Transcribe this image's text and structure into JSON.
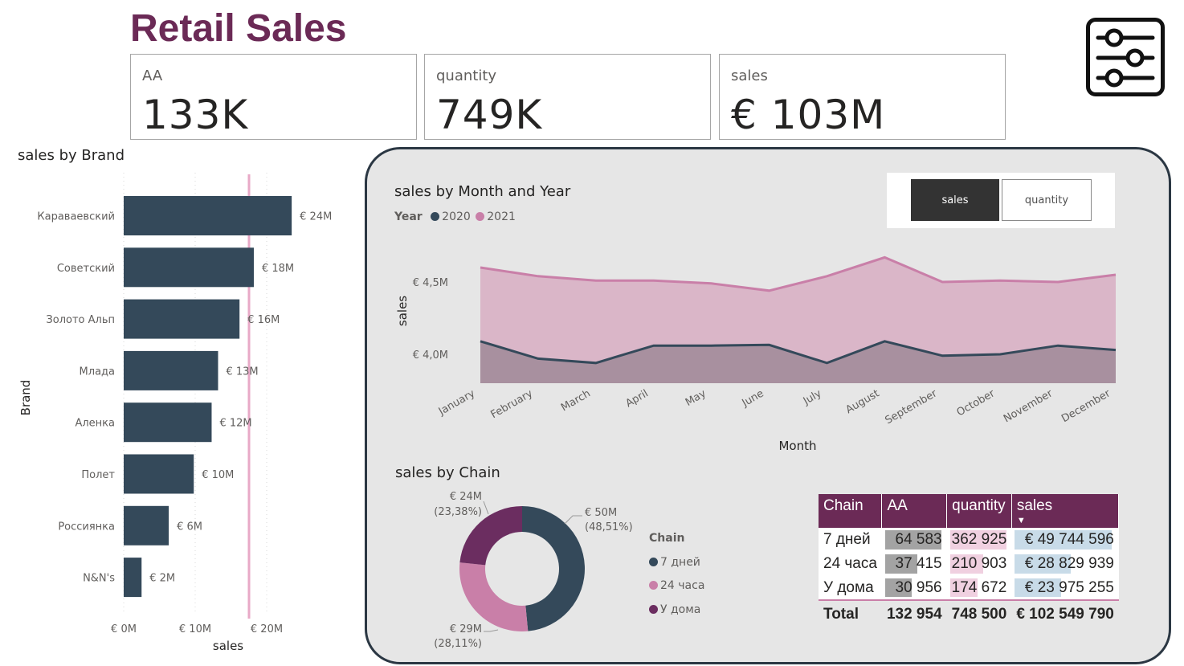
{
  "page": {
    "title": "Retail Sales"
  },
  "kpis": [
    {
      "label": "AA",
      "value": "133K"
    },
    {
      "label": "quantity",
      "value": "749K"
    },
    {
      "label": "sales",
      "value": "€ 103M"
    }
  ],
  "filter_button": {
    "icon": "sliders-icon"
  },
  "brand_chart": {
    "title": "sales by Brand",
    "xlabel": "sales",
    "ylabel": "Brand",
    "x_ticks": [
      "€ 0M",
      "€ 10M",
      "€ 20M"
    ],
    "reference_line_value": 20,
    "bar_color": "#34495a",
    "ref_color": "#e8a9c7"
  },
  "month_chart": {
    "title": "sales by Month and Year",
    "legend_title": "Year",
    "ylabel": "sales",
    "xlabel": "Month",
    "y_ticks": [
      "€ 4,5M",
      "€ 4,0M"
    ],
    "series_colors": {
      "2020": "#34495a",
      "2021": "#c97fa8"
    }
  },
  "measure_toggle": {
    "active": "sales",
    "inactive": "quantity"
  },
  "chain_chart": {
    "title": "sales by Chain",
    "legend_title": "Chain",
    "labels": [
      {
        "value": "€ 50M",
        "pct": "(48,51%)"
      },
      {
        "value": "€ 29M",
        "pct": "(28,11%)"
      },
      {
        "value": "€ 24M",
        "pct": "(23,38%)"
      }
    ]
  },
  "matrix": {
    "headers": [
      "Chain",
      "AA",
      "quantity",
      "sales"
    ],
    "rows": [
      {
        "chain": "7 дней",
        "aa": "64 583",
        "quantity": "362 925",
        "sales": "€ 49 744 596"
      },
      {
        "chain": "24 часа",
        "aa": "37 415",
        "quantity": "210 903",
        "sales": "€ 28 829 939"
      },
      {
        "chain": "У дома",
        "aa": "30 956",
        "quantity": "174 672",
        "sales": "€ 23 975 255"
      }
    ],
    "total": {
      "label": "Total",
      "aa": "132 954",
      "quantity": "748 500",
      "sales": "€ 102 549 790"
    }
  },
  "chart_data": [
    {
      "type": "bar",
      "title": "sales by Brand",
      "xlabel": "sales",
      "ylabel": "Brand",
      "categories": [
        "Караваевский",
        "Советский",
        "Золото Альп",
        "Млада",
        "Аленка",
        "Полет",
        "Россиянка",
        "N&N's"
      ],
      "values": [
        23.5,
        18.2,
        16.2,
        13.2,
        12.3,
        9.8,
        6.3,
        2.5
      ],
      "data_labels": [
        "€ 24M",
        "€ 18M",
        "€ 16M",
        "€ 13M",
        "€ 12M",
        "€ 10M",
        "€ 6M",
        "€ 2M"
      ],
      "xlim": [
        0,
        30
      ]
    },
    {
      "type": "area",
      "title": "sales by Month and Year",
      "xlabel": "Month",
      "ylabel": "sales",
      "categories": [
        "January",
        "February",
        "March",
        "April",
        "May",
        "June",
        "July",
        "August",
        "September",
        "October",
        "November",
        "December"
      ],
      "series": [
        {
          "name": "2020",
          "values": [
            4.09,
            3.97,
            3.94,
            4.06,
            4.06,
            4.065,
            3.94,
            4.09,
            3.99,
            4.0,
            4.06,
            4.03
          ]
        },
        {
          "name": "2021",
          "values": [
            4.6,
            4.54,
            4.51,
            4.51,
            4.49,
            4.44,
            4.54,
            4.67,
            4.5,
            4.51,
            4.5,
            4.55
          ]
        }
      ],
      "ylim": [
        3.8,
        4.75
      ]
    },
    {
      "type": "pie",
      "title": "sales by Chain",
      "categories": [
        "7 дней",
        "24 часа",
        "У дома"
      ],
      "values": [
        48.51,
        28.11,
        23.38
      ],
      "colors": [
        "#34495a",
        "#c97fa8",
        "#6b2d60"
      ]
    }
  ]
}
